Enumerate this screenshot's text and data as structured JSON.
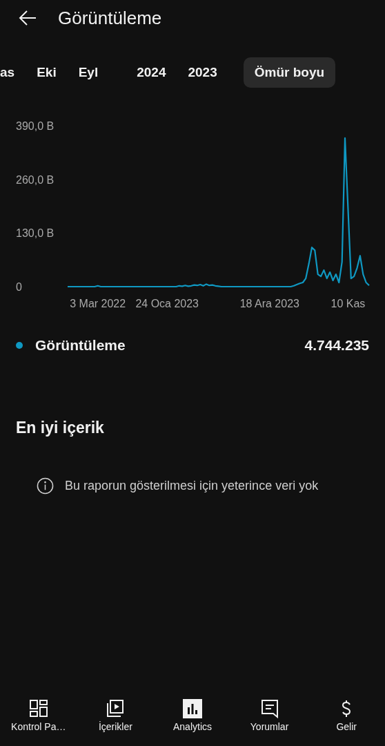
{
  "header": {
    "title": "Görüntüleme"
  },
  "tabs": [
    {
      "label": "as",
      "selected": false
    },
    {
      "label": "Eki",
      "selected": false
    },
    {
      "label": "Eyl",
      "selected": false
    },
    {
      "label": "2024",
      "selected": false
    },
    {
      "label": "2023",
      "selected": false
    },
    {
      "label": "Ömür boyu",
      "selected": true
    }
  ],
  "chart_data": {
    "type": "line",
    "ylim": [
      0,
      390
    ],
    "yticks": [
      {
        "value": 0,
        "label": "0"
      },
      {
        "value": 130,
        "label": "130,0 B"
      },
      {
        "value": 260,
        "label": "260,0 B"
      },
      {
        "value": 390,
        "label": "390,0 B"
      }
    ],
    "categories": [
      null,
      null,
      null,
      null,
      null,
      null,
      null,
      null,
      null,
      null,
      "3 Mar 2022",
      null,
      null,
      null,
      null,
      null,
      null,
      null,
      null,
      null,
      null,
      null,
      null,
      null,
      null,
      null,
      null,
      null,
      null,
      null,
      null,
      null,
      null,
      "24 Oca 2023",
      null,
      null,
      null,
      null,
      null,
      null,
      null,
      null,
      null,
      null,
      null,
      null,
      null,
      null,
      null,
      null,
      null,
      null,
      null,
      null,
      null,
      null,
      null,
      null,
      null,
      null,
      null,
      null,
      null,
      null,
      null,
      null,
      null,
      "18 Ara 2023",
      null,
      null,
      null,
      null,
      null,
      null,
      null,
      null,
      null,
      null,
      null,
      null,
      null,
      null,
      null,
      null,
      null,
      null,
      null,
      null,
      null,
      null,
      null,
      null,
      null,
      "10 Kas",
      null,
      null,
      null,
      null,
      null,
      null,
      null
    ],
    "series": [
      {
        "name": "Görüntüleme",
        "color": "#0f98c2",
        "values": [
          0,
          0,
          0,
          0,
          0,
          0,
          0,
          0,
          0,
          0,
          2,
          0,
          0,
          0,
          0,
          0,
          0,
          0,
          0,
          0,
          0,
          0,
          0,
          0,
          0,
          0,
          0,
          0,
          0,
          0,
          0,
          0,
          0,
          0,
          0,
          0,
          0,
          2,
          1,
          3,
          1,
          2,
          4,
          3,
          5,
          2,
          6,
          3,
          4,
          2,
          1,
          0,
          0,
          0,
          0,
          0,
          0,
          0,
          0,
          0,
          0,
          0,
          0,
          0,
          0,
          0,
          0,
          0,
          0,
          0,
          0,
          0,
          0,
          0,
          0,
          2,
          5,
          8,
          10,
          20,
          55,
          95,
          88,
          30,
          25,
          40,
          20,
          35,
          15,
          30,
          10,
          60,
          360,
          190,
          20,
          25,
          45,
          75,
          30,
          10,
          3
        ]
      }
    ]
  },
  "legend": {
    "total": "4.744.235"
  },
  "top_content": {
    "title": "En iyi içerik",
    "message": "Bu raporun gösterilmesi için yeterince veri yok"
  },
  "nav": [
    {
      "kind": "dashboard",
      "label": "Kontrol Pa…",
      "selected": false
    },
    {
      "kind": "content",
      "label": "İçerikler",
      "selected": false
    },
    {
      "kind": "analytics",
      "label": "Analytics",
      "selected": true
    },
    {
      "kind": "comments",
      "label": "Yorumlar",
      "selected": false
    },
    {
      "kind": "earnings",
      "label": "Gelir",
      "selected": false
    }
  ]
}
